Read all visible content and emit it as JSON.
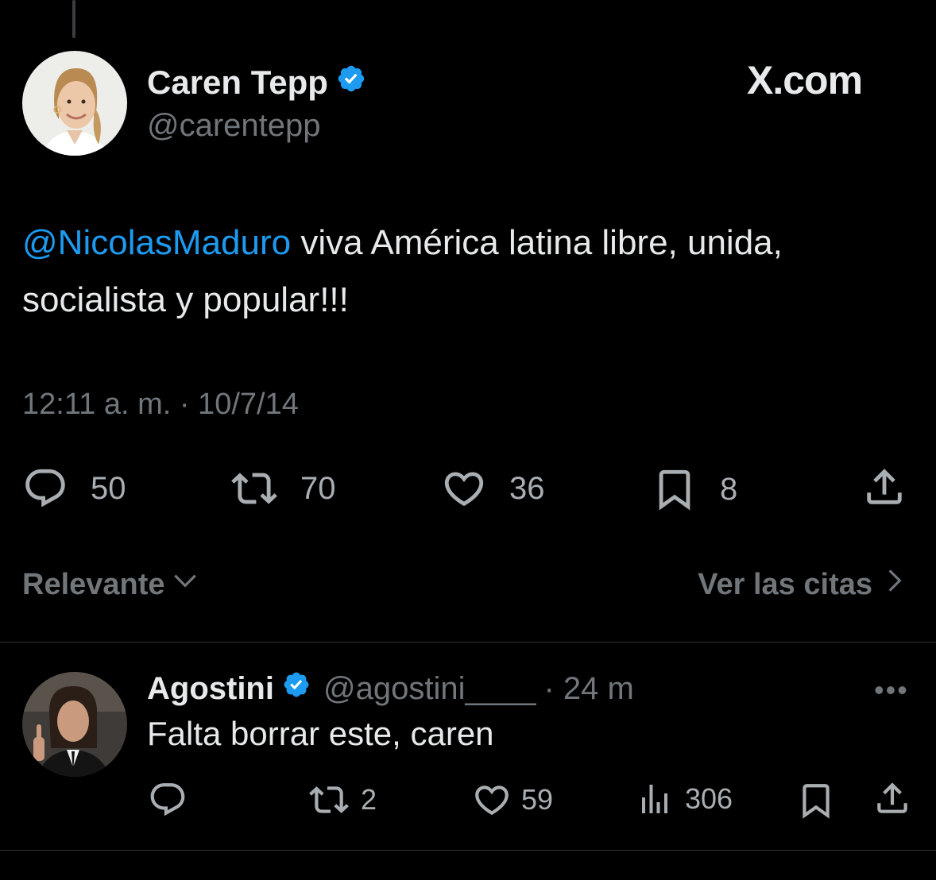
{
  "brand": {
    "watermark": "X.com",
    "accent": "#1d9bf0",
    "background": "#000000"
  },
  "tweet": {
    "author_name": "Caren Tepp",
    "handle": "@carentepp",
    "mention": "@NicolasMaduro",
    "text": " viva América latina libre, unida, socialista y popular!!!",
    "timestamp": "12:11 a. m. · 10/7/14",
    "stats": {
      "replies": "50",
      "reposts": "70",
      "likes": "36",
      "bookmarks": "8"
    }
  },
  "replies_bar": {
    "sort_label": "Relevante",
    "quotes_label": "Ver las citas"
  },
  "reply": {
    "author_name": "Agostini",
    "handle": "@agostini____",
    "time": "· 24 m",
    "text": "Falta borrar este, caren",
    "stats": {
      "reposts": "2",
      "likes": "59",
      "views": "306"
    }
  },
  "icons": [
    "reply-icon",
    "repost-icon",
    "like-icon",
    "bookmark-icon",
    "share-icon",
    "views-icon",
    "verified-badge-icon",
    "chevron-down-icon",
    "chevron-right-icon",
    "more-icon"
  ]
}
